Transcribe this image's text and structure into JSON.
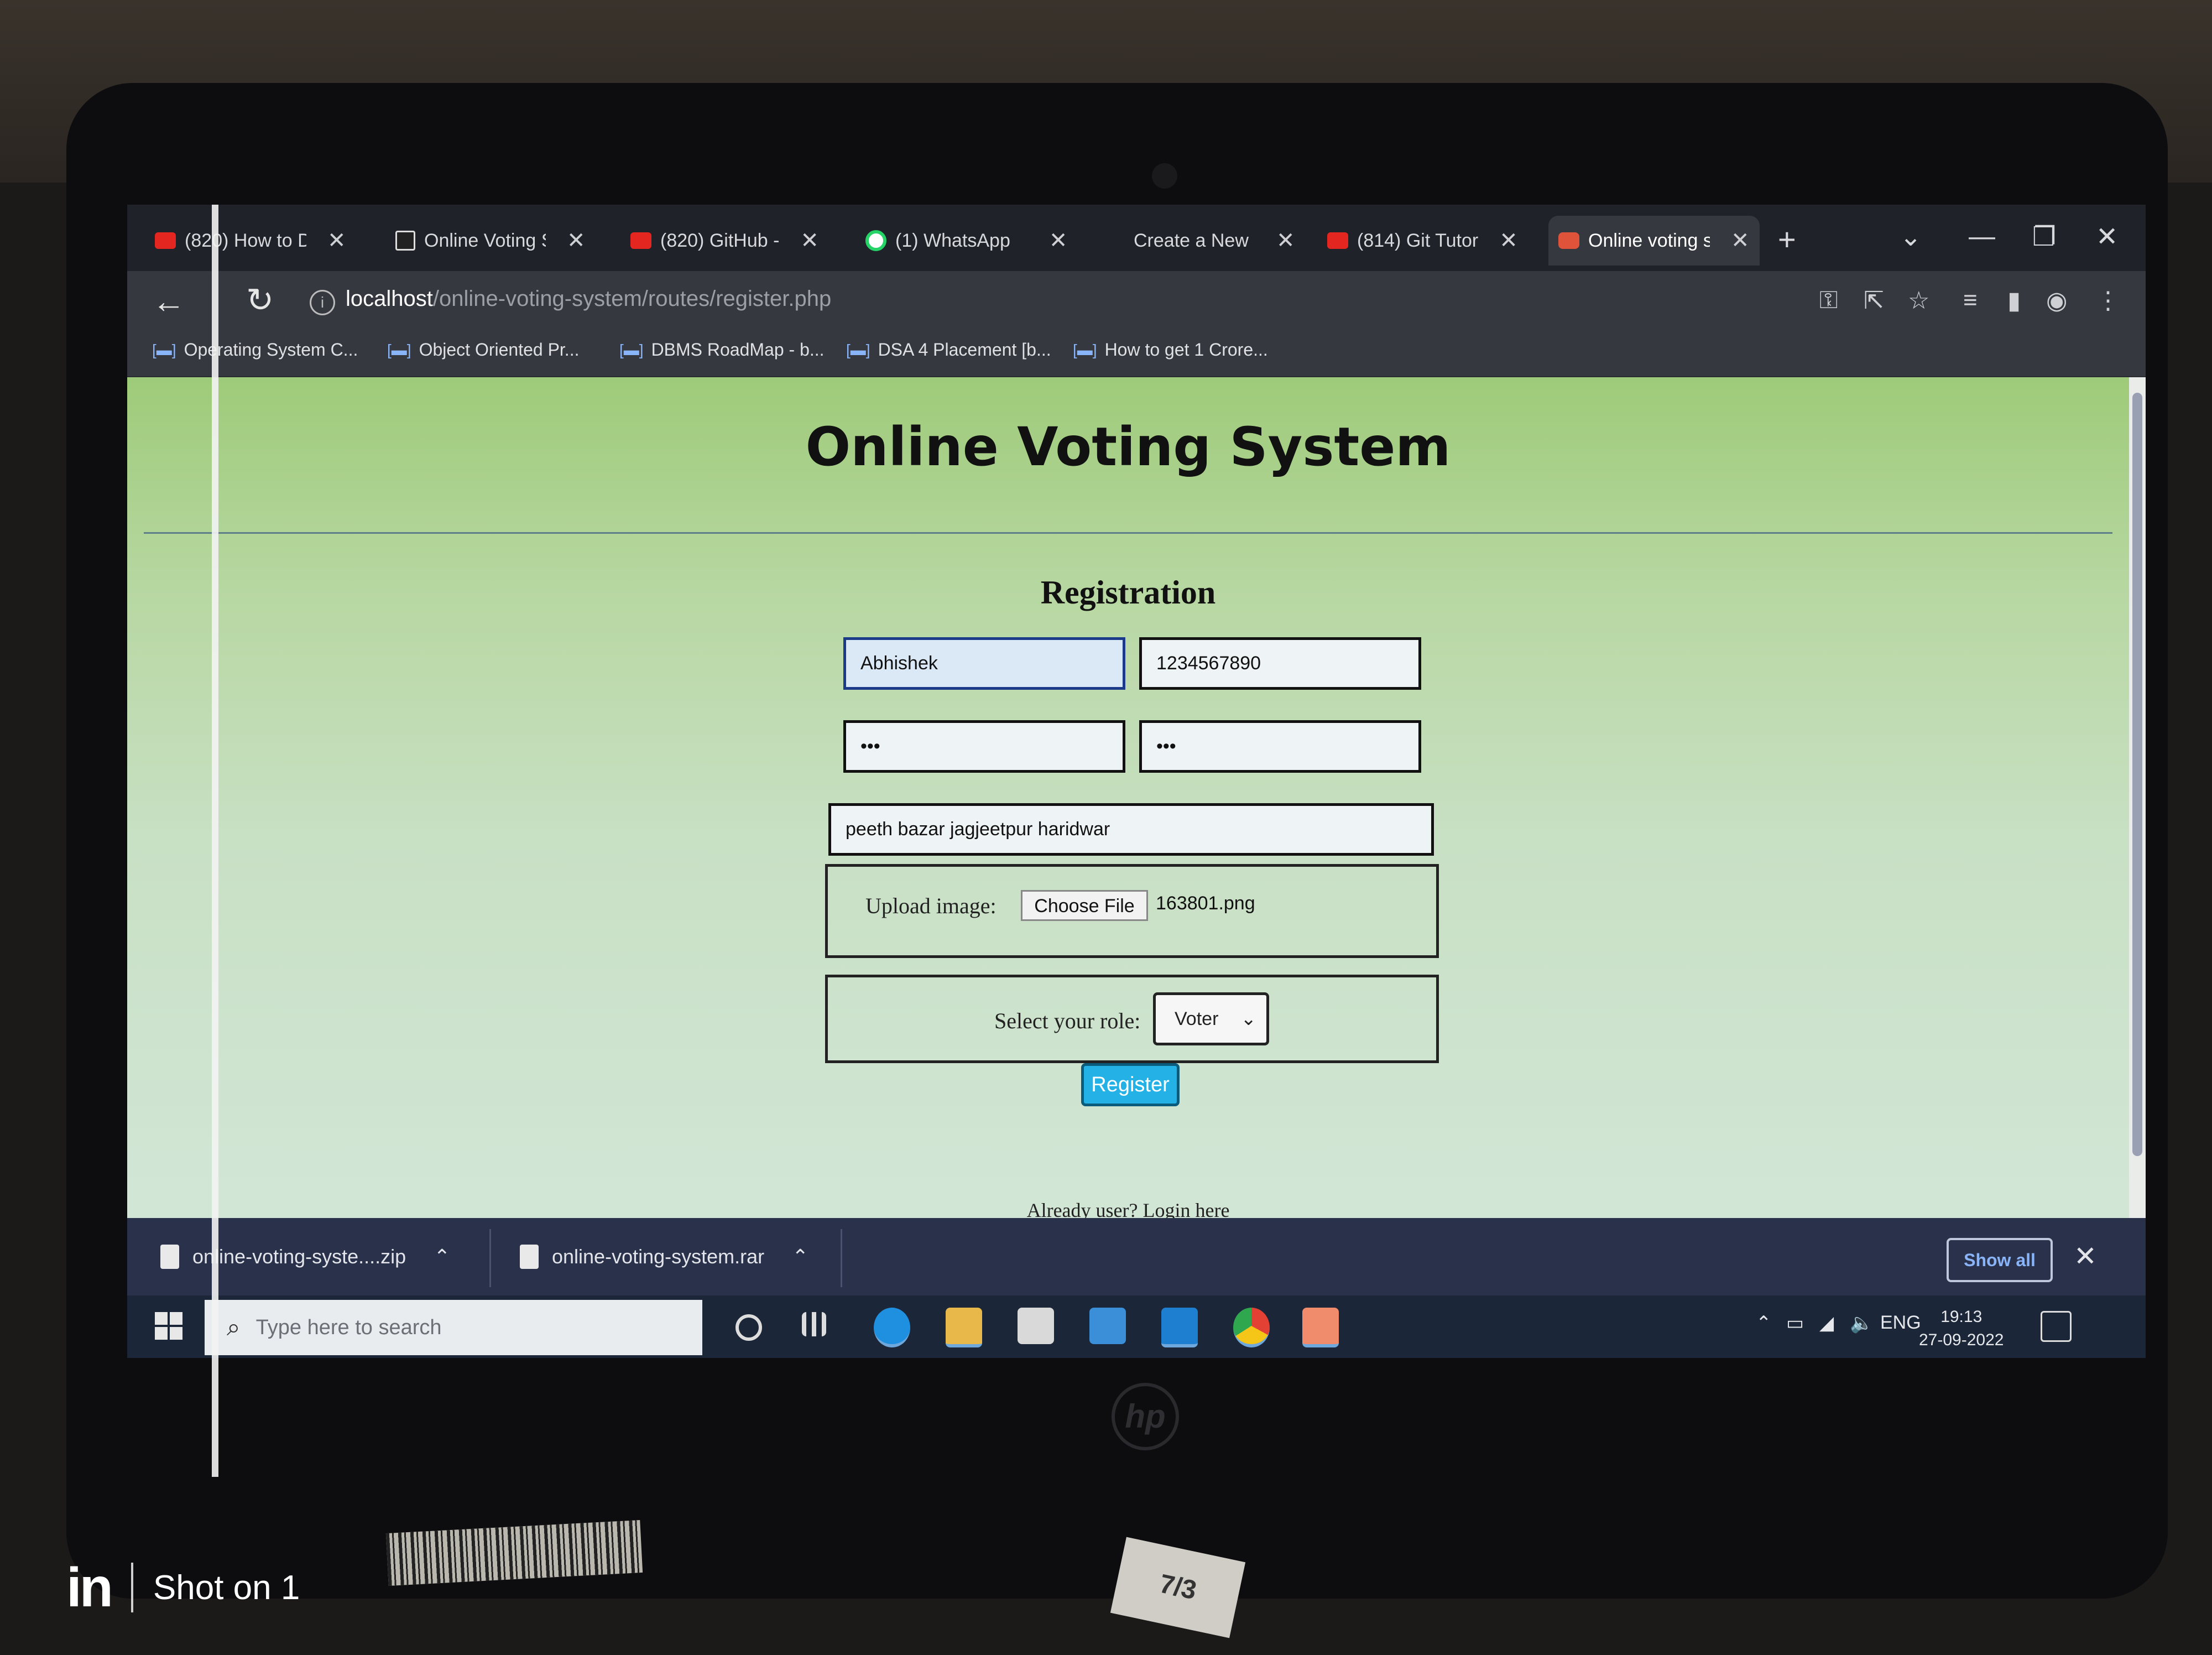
{
  "browser": {
    "tabs": [
      {
        "title": "(820) How to D",
        "icon": "youtube-icon"
      },
      {
        "title": "Online Voting S",
        "icon": "site-icon"
      },
      {
        "title": "(820) GitHub -",
        "icon": "youtube-icon"
      },
      {
        "title": "(1) WhatsApp",
        "icon": "whatsapp-icon"
      },
      {
        "title": "Create a New F",
        "icon": "blank"
      },
      {
        "title": "(814) Git Tutor",
        "icon": "youtube-icon"
      },
      {
        "title": "Online voting s",
        "icon": "xampp-icon",
        "active": true
      }
    ],
    "new_tab": "+",
    "url_host": "localhost",
    "url_path": "/online-voting-system/routes/register.php",
    "bookmarks": [
      "Operating System C...",
      "Object Oriented Pr...",
      "DBMS RoadMap - b...",
      "DSA 4 Placement [b...",
      "How to get 1 Crore..."
    ]
  },
  "page": {
    "title": "Online Voting System",
    "heading": "Registration",
    "name_value": "Abhishek",
    "mobile_value": "1234567890",
    "password_value": "•••",
    "confirm_password_value": "•••",
    "address_value": "peeth bazar jagjeetpur haridwar",
    "upload_label": "Upload image:",
    "choose_file_label": "Choose File",
    "file_name": "163801.png",
    "role_label": "Select your role:",
    "role_selected": "Voter",
    "register_label": "Register",
    "login_link": "Already user? Login here"
  },
  "downloads": {
    "items": [
      "online-voting-syste....zip",
      "online-voting-system.rar"
    ],
    "show_all": "Show all"
  },
  "taskbar": {
    "search_placeholder": "Type here to search",
    "language": "ENG",
    "time": "19:13",
    "date": "27-09-2022"
  },
  "watermark": {
    "brand": "in",
    "text": "Shot on 1"
  }
}
